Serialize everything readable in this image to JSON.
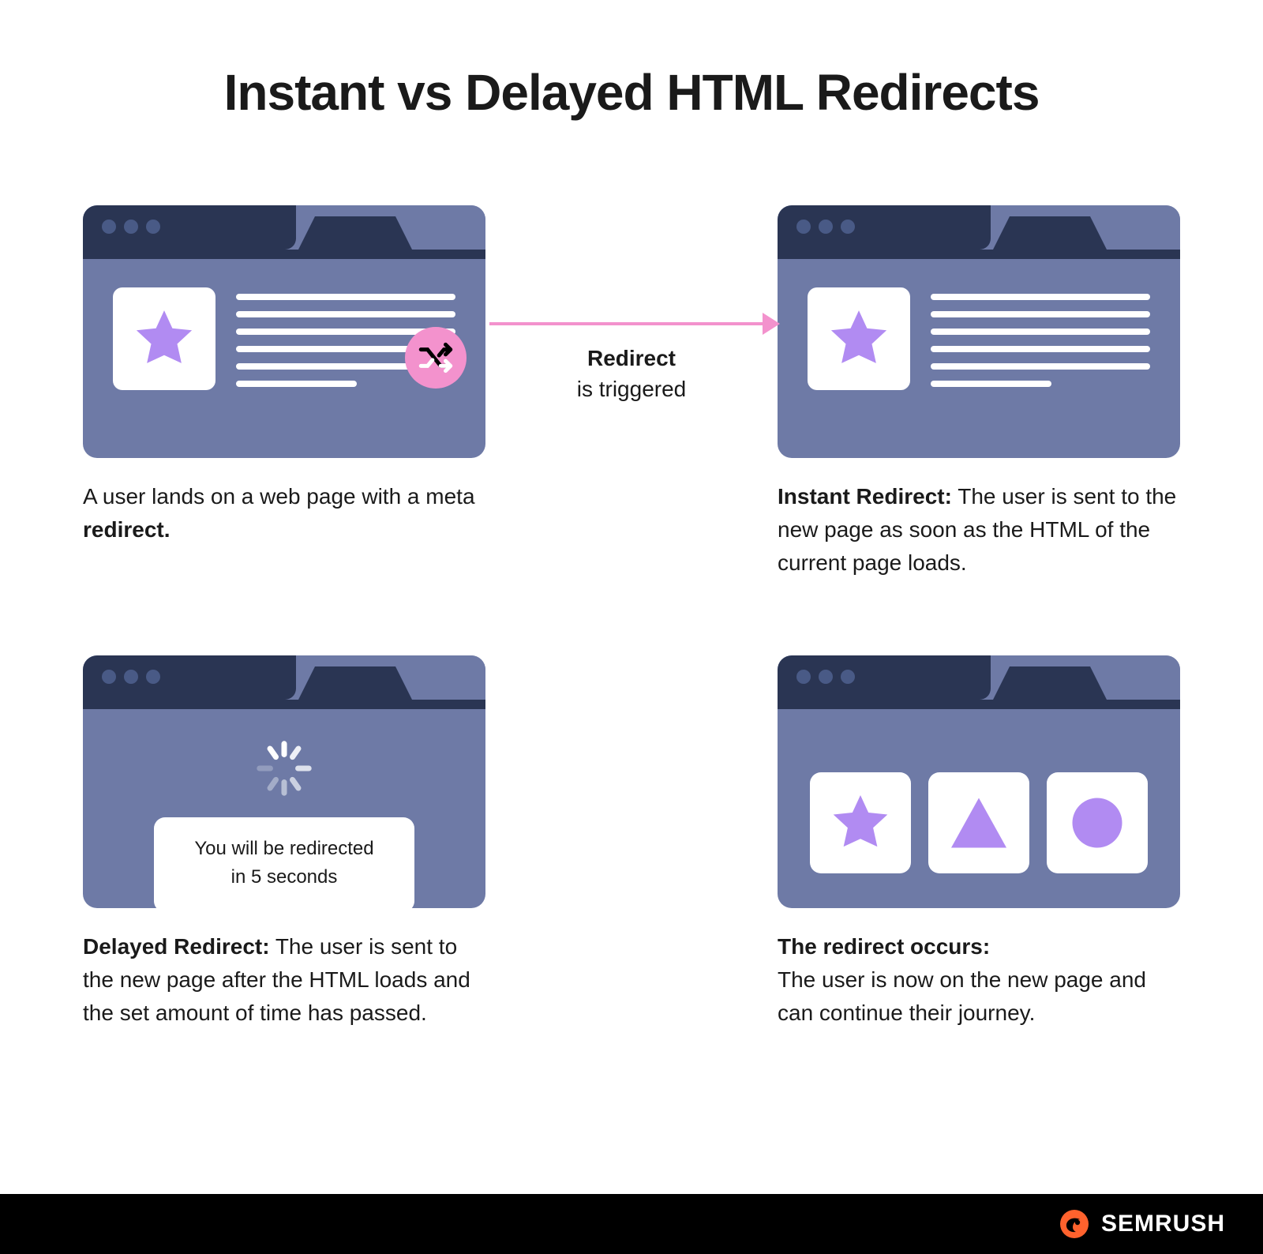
{
  "title": "Instant vs Delayed HTML Redirects",
  "arrow": {
    "label_bold": "Redirect",
    "label_rest": "is triggered"
  },
  "panels": {
    "landing": {
      "caption_lead": "A user lands on a web page with a meta ",
      "caption_bold": "redirect."
    },
    "instant": {
      "caption_bold": "Instant Redirect:",
      "caption_rest": " The user is sent to the new page as soon as the HTML of the current page loads."
    },
    "delayed": {
      "message_line1": "You will be redirected",
      "message_line2": "in 5 seconds",
      "caption_bold": "Delayed Redirect:",
      "caption_rest": " The user is sent to the new page after the HTML loads and the set amount of time has passed."
    },
    "occurs": {
      "caption_bold": "The redirect occurs:",
      "caption_rest": "The user is now on the new page and can continue their journey."
    }
  },
  "footer": {
    "brand": "SEMRUSH"
  },
  "colors": {
    "window_body": "#6e7aa6",
    "window_bar_dark": "#2a3553",
    "accent_purple": "#b18bf2",
    "accent_pink": "#f392cd",
    "brand_orange": "#ff622d"
  }
}
